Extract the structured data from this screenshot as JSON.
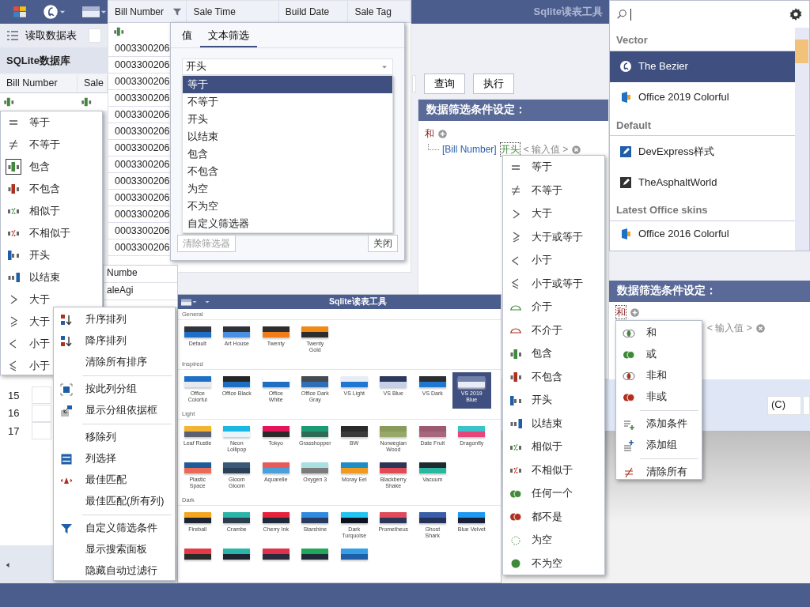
{
  "app": {
    "title": "Sqlite读表工具",
    "toolbar_button": "读取数据表",
    "db_panel_title": "SQLite数据库",
    "left_grid_columns": [
      "Bill Number",
      "Sale"
    ],
    "query_buttons": [
      "查询",
      "执行"
    ],
    "row_numbers": [
      "15",
      "16",
      "17"
    ],
    "side_field": "(C)"
  },
  "grid": {
    "columns": [
      {
        "label": "Bill Number",
        "filtered": true
      },
      {
        "label": "Sale Time",
        "filtered": false
      },
      {
        "label": "Build Date",
        "filtered": false
      },
      {
        "label": "Sale Tag",
        "filtered": false
      }
    ],
    "rows": [
      "0003300206",
      "0003300206",
      "0003300206",
      "0003300206",
      "0003300206",
      "0003300206",
      "0003300206",
      "0003300206",
      "0003300206",
      "0003300206",
      "0003300206",
      "0003300206",
      "0003300206"
    ]
  },
  "back_grid_texts": [
    "Numbe",
    "aleAgi"
  ],
  "filter_popup": {
    "tabs": [
      {
        "label": "值",
        "selected": false
      },
      {
        "label": "文本筛选",
        "selected": true
      }
    ],
    "combo_value": "开头",
    "options": [
      {
        "label": "等于",
        "selected": true
      },
      {
        "label": "不等于",
        "selected": false
      },
      {
        "label": "开头",
        "selected": false
      },
      {
        "label": "以结束",
        "selected": false
      },
      {
        "label": "包含",
        "selected": false
      },
      {
        "label": "不包含",
        "selected": false
      },
      {
        "label": "为空",
        "selected": false
      },
      {
        "label": "不为空",
        "selected": false
      },
      {
        "label": "自定义筛选器",
        "selected": false
      }
    ],
    "buttons": [
      "清除筛选器",
      "关闭"
    ]
  },
  "left_operator_menu": [
    {
      "label": "等于",
      "kind": "eq",
      "selected": false
    },
    {
      "label": "不等于",
      "kind": "ne",
      "selected": false
    },
    {
      "label": "包含",
      "kind": "contains",
      "selected": true
    },
    {
      "label": "不包含",
      "kind": "notcontains",
      "selected": false
    },
    {
      "label": "相似于",
      "kind": "like",
      "selected": false
    },
    {
      "label": "不相似于",
      "kind": "notlike",
      "selected": false
    },
    {
      "label": "开头",
      "kind": "begins",
      "selected": false
    },
    {
      "label": "以结束",
      "kind": "ends",
      "selected": false
    },
    {
      "label": "大于",
      "kind": "gt",
      "selected": false
    },
    {
      "label": "大于",
      "kind": "ge",
      "selected": false
    },
    {
      "label": "小于",
      "kind": "lt",
      "selected": false
    },
    {
      "label": "小于",
      "kind": "le",
      "selected": false
    }
  ],
  "filter_panel": {
    "title": "数据筛选条件设定：",
    "group_operator": "和",
    "field": "[Bill Number]",
    "operator": "开头",
    "value_placeholder": "< 输入值 >"
  },
  "operator_menu": [
    {
      "label": "等于",
      "kind": "eq"
    },
    {
      "label": "不等于",
      "kind": "ne"
    },
    {
      "label": "大于",
      "kind": "gt"
    },
    {
      "label": "大于或等于",
      "kind": "ge"
    },
    {
      "label": "小于",
      "kind": "lt"
    },
    {
      "label": "小于或等于",
      "kind": "le"
    },
    {
      "label": "介于",
      "kind": "between"
    },
    {
      "label": "不介于",
      "kind": "notbetween"
    },
    {
      "label": "包含",
      "kind": "contains"
    },
    {
      "label": "不包含",
      "kind": "notcontains"
    },
    {
      "label": "开头",
      "kind": "begins"
    },
    {
      "label": "以结束",
      "kind": "ends"
    },
    {
      "label": "相似于",
      "kind": "like"
    },
    {
      "label": "不相似于",
      "kind": "notlike"
    },
    {
      "label": "任何一个",
      "kind": "anyof"
    },
    {
      "label": "都不是",
      "kind": "noneof"
    },
    {
      "label": "为空",
      "kind": "isnull"
    },
    {
      "label": "不为空",
      "kind": "notnull"
    }
  ],
  "skin_list": {
    "groups": [
      {
        "title": "Vector",
        "items": [
          {
            "label": "The Bezier",
            "kind": "bezier",
            "selected": true
          },
          {
            "label": "Office 2019 Colorful",
            "kind": "office",
            "selected": false
          }
        ]
      },
      {
        "title": "Default",
        "items": [
          {
            "label": "DevExpress样式",
            "kind": "devx",
            "selected": false
          },
          {
            "label": "TheAsphaltWorld",
            "kind": "asphalt",
            "selected": false
          }
        ]
      },
      {
        "title": "Latest Office skins",
        "items": [
          {
            "label": "Office 2016 Colorful",
            "kind": "office",
            "selected": false
          }
        ]
      }
    ]
  },
  "filter_panel_2": {
    "title": "数据筛选条件设定：",
    "group_operator": "和",
    "value_placeholder": "< 输入值 >"
  },
  "logic_menu": {
    "sections": [
      [
        {
          "label": "和",
          "kind": "and"
        },
        {
          "label": "或",
          "kind": "or"
        },
        {
          "label": "非和",
          "kind": "nand"
        },
        {
          "label": "非或",
          "kind": "nor"
        }
      ],
      [
        {
          "label": "添加条件",
          "kind": "addcond"
        },
        {
          "label": "添加组",
          "kind": "addgroup"
        }
      ],
      [
        {
          "label": "清除所有",
          "kind": "clear"
        }
      ]
    ]
  },
  "skin_gallery": {
    "title": "Sqlite读表工具",
    "groups": [
      {
        "title": "General",
        "skins": [
          {
            "label": "Default",
            "selected": false,
            "stripes": [
              {
                "color": "#30343c"
              },
              {
                "color": "#1e6ec8"
              }
            ]
          },
          {
            "label": "Art House",
            "selected": false,
            "stripes": [
              {
                "color": "#2e3138"
              },
              {
                "color": "#4a90e2"
              }
            ]
          },
          {
            "label": "Twenty",
            "selected": false,
            "stripes": [
              {
                "color": "#2d2d2d"
              },
              {
                "color": "#f07c1a"
              }
            ]
          },
          {
            "label": "Twenty Gold",
            "selected": false,
            "stripes": [
              {
                "color": "#f08a14"
              },
              {
                "color": "#2d2d2d"
              }
            ]
          }
        ]
      },
      {
        "title": "Inspired",
        "skins": [
          {
            "label": "Office Colorful",
            "selected": false,
            "stripes": [
              {
                "color": "#1f6fc5"
              },
              {
                "color": "#e6e9ef"
              }
            ]
          },
          {
            "label": "Office Black",
            "selected": false,
            "stripes": [
              {
                "color": "#252525"
              },
              {
                "color": "#1e6fc2"
              }
            ]
          },
          {
            "label": "Office White",
            "selected": false,
            "stripes": [
              {
                "color": "#ffffff"
              },
              {
                "color": "#1e6fc2"
              }
            ]
          },
          {
            "label": "Office Dark Gray",
            "selected": false,
            "stripes": [
              {
                "color": "#444a52"
              },
              {
                "color": "#2f6fb5"
              }
            ]
          },
          {
            "label": "VS Light",
            "selected": false,
            "stripes": [
              {
                "color": "#e8ecf5"
              },
              {
                "color": "#1e78d2"
              }
            ]
          },
          {
            "label": "VS Blue",
            "selected": false,
            "stripes": [
              {
                "color": "#2b3a5c"
              },
              {
                "color": "#c7d0e6"
              }
            ]
          },
          {
            "label": "VS Dark",
            "selected": false,
            "stripes": [
              {
                "color": "#2d2d30"
              },
              {
                "color": "#1e78d2"
              }
            ]
          },
          {
            "label": "VS 2019 Blue",
            "selected": true,
            "stripes": [
              {
                "color": "#7080a8"
              },
              {
                "color": "#e8ecf8"
              }
            ]
          }
        ]
      },
      {
        "title": "Light",
        "skins": [
          {
            "label": "Leaf Rustle",
            "selected": false,
            "stripes": [
              {
                "color": "#f2b531"
              },
              {
                "color": "#5b5f72"
              }
            ]
          },
          {
            "label": "Neon Lollipop",
            "selected": false,
            "stripes": [
              {
                "color": "#1cb8e4"
              },
              {
                "color": "#e6f6fb"
              }
            ]
          },
          {
            "label": "Tokyo",
            "selected": false,
            "stripes": [
              {
                "color": "#e3145a"
              },
              {
                "color": "#2a2a2a"
              }
            ]
          },
          {
            "label": "Grasshopper",
            "selected": false,
            "stripes": [
              {
                "color": "#1c9a74"
              },
              {
                "color": "#2d6b57"
              }
            ]
          },
          {
            "label": "BW",
            "selected": false,
            "stripes": [
              {
                "color": "#2a2a2a"
              },
              {
                "color": "#3a3a3a"
              }
            ]
          },
          {
            "label": "Norwegian Wood",
            "selected": false,
            "stripes": [
              {
                "color": "#8a9a5b"
              },
              {
                "color": "#98a868"
              }
            ]
          },
          {
            "label": "Date Fruit",
            "selected": false,
            "stripes": [
              {
                "color": "#9b5a6e"
              },
              {
                "color": "#a8687c"
              }
            ]
          },
          {
            "label": "Dragonfly",
            "selected": false,
            "stripes": [
              {
                "color": "#3cc3c8"
              },
              {
                "color": "#e8457a"
              }
            ]
          },
          {
            "label": "Plastic Space",
            "selected": false,
            "stripes": [
              {
                "color": "#1f5b9a"
              },
              {
                "color": "#e96b55"
              }
            ]
          },
          {
            "label": "Gloom Gloom",
            "selected": false,
            "stripes": [
              {
                "color": "#3b5878"
              },
              {
                "color": "#2a3f58"
              }
            ]
          },
          {
            "label": "Aquarelle",
            "selected": false,
            "stripes": [
              {
                "color": "#e65a5a"
              },
              {
                "color": "#4aa0d8"
              }
            ]
          },
          {
            "label": "Oxygen 3",
            "selected": false,
            "stripes": [
              {
                "color": "#a8dfe0"
              },
              {
                "color": "#7b7b7b"
              }
            ]
          },
          {
            "label": "Moray Eel",
            "selected": false,
            "stripes": [
              {
                "color": "#1c8dc7"
              },
              {
                "color": "#f09a1e"
              }
            ]
          },
          {
            "label": "Blackberry Shake",
            "selected": false,
            "stripes": [
              {
                "color": "#2e3556"
              },
              {
                "color": "#e04b55"
              }
            ]
          },
          {
            "label": "Vacuum",
            "selected": false,
            "stripes": [
              {
                "color": "#1c2b2f"
              },
              {
                "color": "#28b7a0"
              }
            ]
          }
        ]
      },
      {
        "title": "Dark",
        "skins": [
          {
            "label": "Fireball",
            "selected": false,
            "stripes": [
              {
                "color": "#f4a71e"
              },
              {
                "color": "#1e2532"
              }
            ]
          },
          {
            "label": "Crambe",
            "selected": false,
            "stripes": [
              {
                "color": "#2bb5a8"
              },
              {
                "color": "#2b3d4f"
              }
            ]
          },
          {
            "label": "Cherry Ink",
            "selected": false,
            "stripes": [
              {
                "color": "#e8223a"
              },
              {
                "color": "#1e2a3a"
              }
            ]
          },
          {
            "label": "Starshine",
            "selected": false,
            "stripes": [
              {
                "color": "#2f8be0"
              },
              {
                "color": "#2a3b62"
              }
            ]
          },
          {
            "label": "Dark Turquoise",
            "selected": false,
            "stripes": [
              {
                "color": "#22c4f0"
              },
              {
                "color": "#0b1220"
              }
            ]
          },
          {
            "label": "Prometheus",
            "selected": false,
            "stripes": [
              {
                "color": "#e04a5a"
              },
              {
                "color": "#2b3658"
              }
            ]
          },
          {
            "label": "Ghost Shark",
            "selected": false,
            "stripes": [
              {
                "color": "#3a5fa8"
              },
              {
                "color": "#22325a"
              }
            ]
          },
          {
            "label": "Blue Velvet",
            "selected": false,
            "stripes": [
              {
                "color": "#1e98f0"
              },
              {
                "color": "#17223a"
              }
            ]
          },
          {
            "selected": false,
            "stripes": [
              {
                "color": "#e63946"
              },
              {
                "color": "#2a2a2a"
              }
            ]
          },
          {
            "selected": false,
            "stripes": [
              {
                "color": "#2bb5a8"
              },
              {
                "color": "#1b2430"
              }
            ]
          },
          {
            "selected": false,
            "stripes": [
              {
                "color": "#e0304a"
              },
              {
                "color": "#2a2a3a"
              }
            ]
          },
          {
            "selected": false,
            "stripes": [
              {
                "color": "#1fa85a"
              },
              {
                "color": "#1e2a38"
              }
            ]
          },
          {
            "selected": false,
            "stripes": [
              {
                "color": "#35a0e8"
              },
              {
                "color": "#1e5fa8"
              }
            ]
          }
        ]
      }
    ]
  },
  "context_menu": {
    "sections": [
      [
        {
          "label": "升序排列",
          "kind": "asc"
        },
        {
          "label": "降序排列",
          "kind": "desc"
        },
        {
          "label": "清除所有排序",
          "kind": "none"
        }
      ],
      [
        {
          "label": "按此列分组",
          "kind": "group"
        },
        {
          "label": "显示分组依据框",
          "kind": "groupbox"
        }
      ],
      [
        {
          "label": "移除列",
          "kind": "none"
        },
        {
          "label": "列选择",
          "kind": "colchooser"
        },
        {
          "label": "最佳匹配",
          "kind": "bestfit"
        },
        {
          "label": "最佳匹配(所有列)",
          "kind": "none"
        }
      ],
      [
        {
          "label": "自定义筛选条件",
          "kind": "filter"
        },
        {
          "label": "显示搜索面板",
          "kind": "none"
        },
        {
          "label": "隐藏自动过滤行",
          "kind": "none"
        }
      ]
    ]
  }
}
